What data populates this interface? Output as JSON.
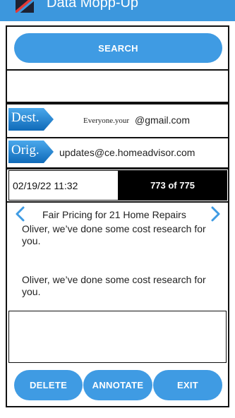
{
  "app": {
    "title": "Data Mopp-Up"
  },
  "search": {
    "label": "SEARCH"
  },
  "dest": {
    "tag": "Dest.",
    "prefix": "Everyone.your",
    "suffix": "@gmail.com"
  },
  "orig": {
    "tag": "Orig.",
    "value": "updates@ce.homeadvisor.com"
  },
  "message": {
    "datetime": "02/19/22 11:32",
    "counter": "773 of 775",
    "subject": "Fair Pricing for 21 Home Repairs",
    "preview1": "Oliver, we’ve done some cost research for you.",
    "preview2": "Oliver, we’ve done some cost research for you."
  },
  "annotation": {
    "value": ""
  },
  "actions": {
    "delete": "DELETE",
    "annotate": "ANNOTATE",
    "exit": "EXIT"
  },
  "colors": {
    "accent": "#3f9be3",
    "tag_blue": "#1878c8",
    "counter_bg": "#000000"
  },
  "icons": {
    "prev": "chevron-left-icon",
    "next": "chevron-right-icon"
  }
}
